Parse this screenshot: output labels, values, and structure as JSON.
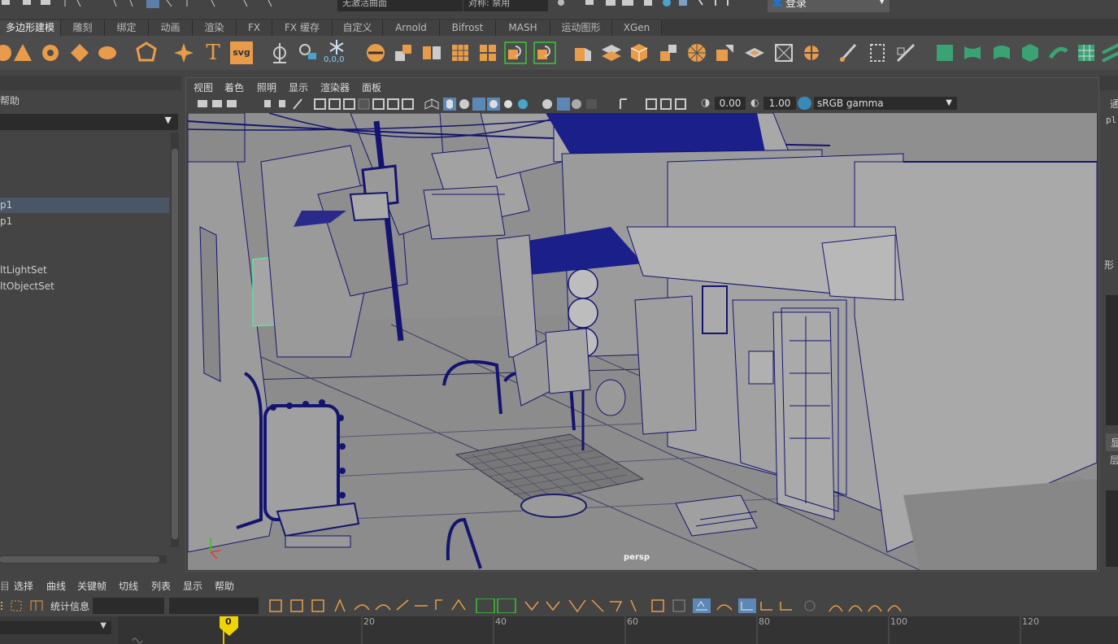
{
  "topbar": {
    "combo_left": "无激活曲面",
    "combo_right": "对称: 禁用",
    "login_label": "登录"
  },
  "shelf_tabs": [
    "多边形建模",
    "雕刻",
    "绑定",
    "动画",
    "渲染",
    "FX",
    "FX 缓存",
    "自定义",
    "Arnold",
    "Bifrost",
    "MASH",
    "运动图形",
    "XGen"
  ],
  "shelf_tab_active": 0,
  "shelf_text_icons": {
    "text_tool": "T",
    "svg_tool": "svg",
    "coord": "0,0,0"
  },
  "outliner": {
    "help_menu": "帮助",
    "items": [
      "p1",
      "p1",
      "ltLightSet",
      "ltObjectSet"
    ]
  },
  "viewport": {
    "menu": [
      "视图",
      "着色",
      "照明",
      "显示",
      "渲染器",
      "面板"
    ],
    "exposure": "0.00",
    "gamma": "1.00",
    "colorspace": "sRGB gamma",
    "camera_label": "persp"
  },
  "right_panel": {
    "label_top": "通",
    "label_code": "pl",
    "label_mid": "形",
    "label_bottom_a": "显",
    "label_bottom_b": "层"
  },
  "bottom_menu": [
    "选择",
    "曲线",
    "关键帧",
    "切线",
    "列表",
    "显示",
    "帮助"
  ],
  "bottom_tools": {
    "stats_label": "统计信息"
  },
  "timeline": {
    "current_frame": "0",
    "ticks": [
      "20",
      "40",
      "60",
      "80",
      "100",
      "120"
    ]
  },
  "colors": {
    "accent_orange": "#e89c4a",
    "wire_blue": "#0c137a",
    "select_green": "#5fe0a0"
  }
}
